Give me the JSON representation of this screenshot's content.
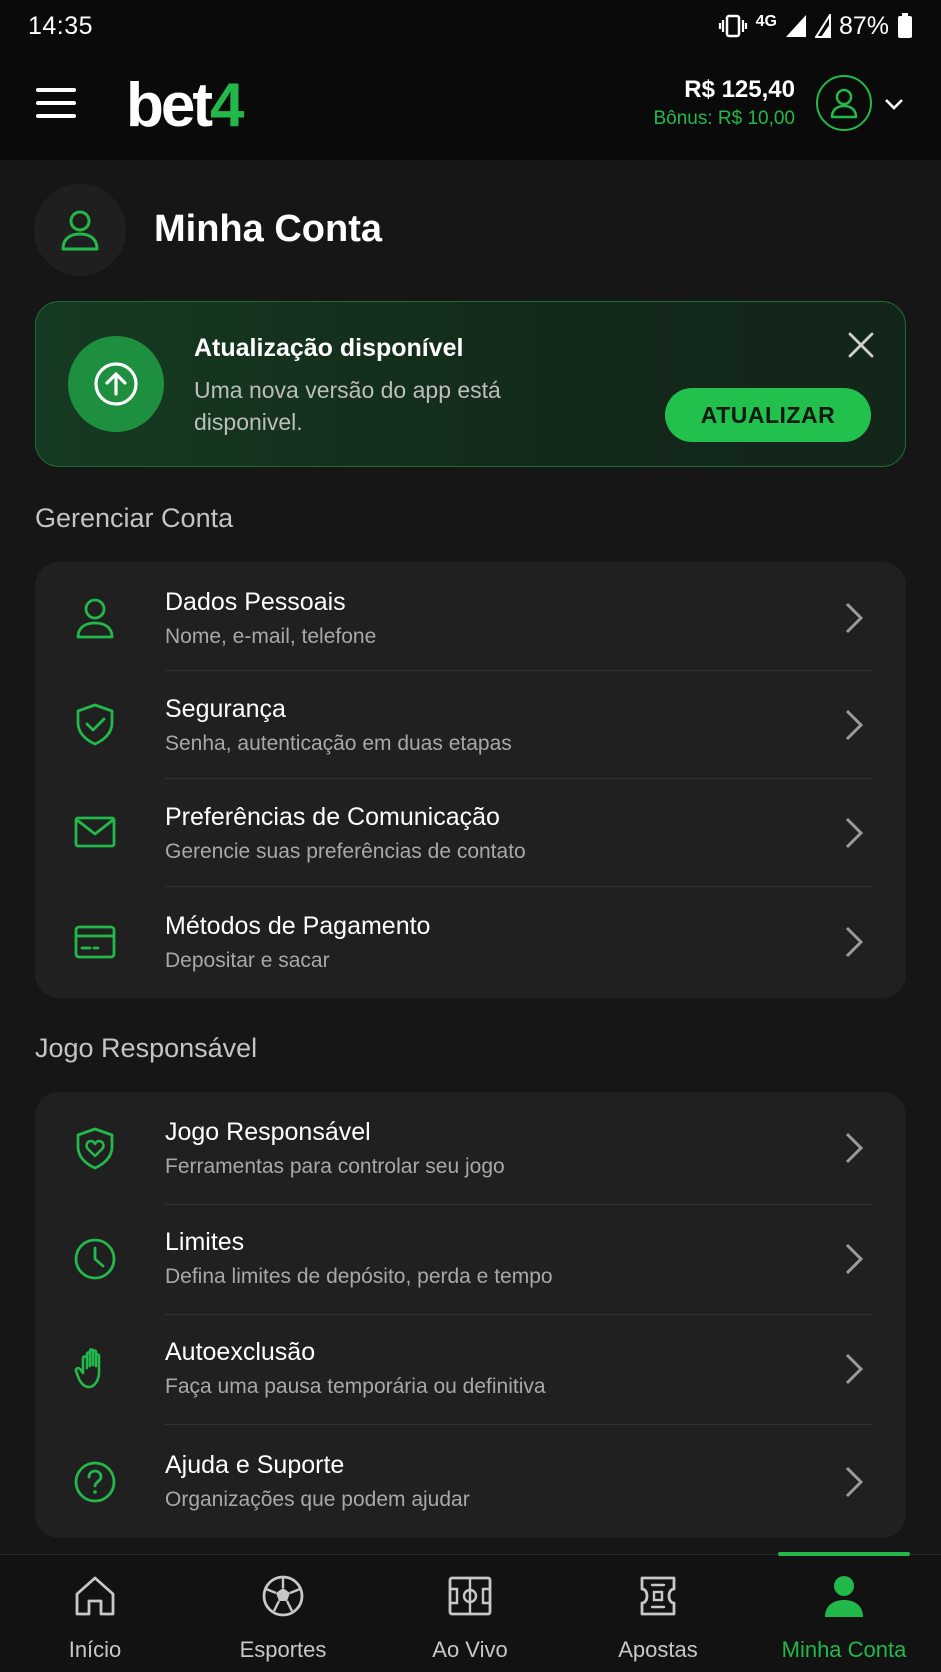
{
  "status_bar": {
    "time": "14:35",
    "network": "4G",
    "battery": "87%"
  },
  "header": {
    "logo_main": "bet",
    "logo_accent": "4",
    "balance": "R$ 125,40",
    "bonus": "Bônus: R$ 10,00"
  },
  "page": {
    "title": "Minha Conta"
  },
  "update_banner": {
    "title": "Atualização disponível",
    "text": "Uma nova versão do app está disponivel.",
    "button": "ATUALIZAR"
  },
  "sections": {
    "manage": {
      "title": "Gerenciar Conta",
      "items": [
        {
          "label": "Dados Pessoais",
          "sub": "Nome, e-mail, telefone",
          "icon": "user-icon"
        },
        {
          "label": "Segurança",
          "sub": "Senha, autenticação em duas etapas",
          "icon": "shield-check-icon"
        },
        {
          "label": "Preferências de Comunicação",
          "sub": "Gerencie suas preferências de contato",
          "icon": "mail-icon"
        },
        {
          "label": "Métodos de Pagamento",
          "sub": "Depositar e sacar",
          "icon": "credit-card-icon"
        }
      ]
    },
    "responsible": {
      "title": "Jogo Responsável",
      "items": [
        {
          "label": "Jogo Responsável",
          "sub": "Ferramentas para controlar seu jogo",
          "icon": "shield-heart-icon"
        },
        {
          "label": "Limites",
          "sub": "Defina limites de depósito, perda e tempo",
          "icon": "clock-icon"
        },
        {
          "label": "Autoexclusão",
          "sub": "Faça uma pausa temporária ou definitiva",
          "icon": "hand-icon"
        },
        {
          "label": "Ajuda e Suporte",
          "sub": "Organizações que podem ajudar",
          "icon": "help-circle-icon"
        }
      ]
    }
  },
  "bottom_nav": [
    {
      "label": "Início",
      "icon": "home-icon"
    },
    {
      "label": "Esportes",
      "icon": "soccer-ball-icon"
    },
    {
      "label": "Ao Vivo",
      "icon": "field-icon"
    },
    {
      "label": "Apostas",
      "icon": "ticket-icon"
    },
    {
      "label": "Minha Conta",
      "icon": "user-filled-icon",
      "active": true
    }
  ],
  "colors": {
    "accent": "#22b84a",
    "background": "#161616",
    "card": "#202020"
  }
}
